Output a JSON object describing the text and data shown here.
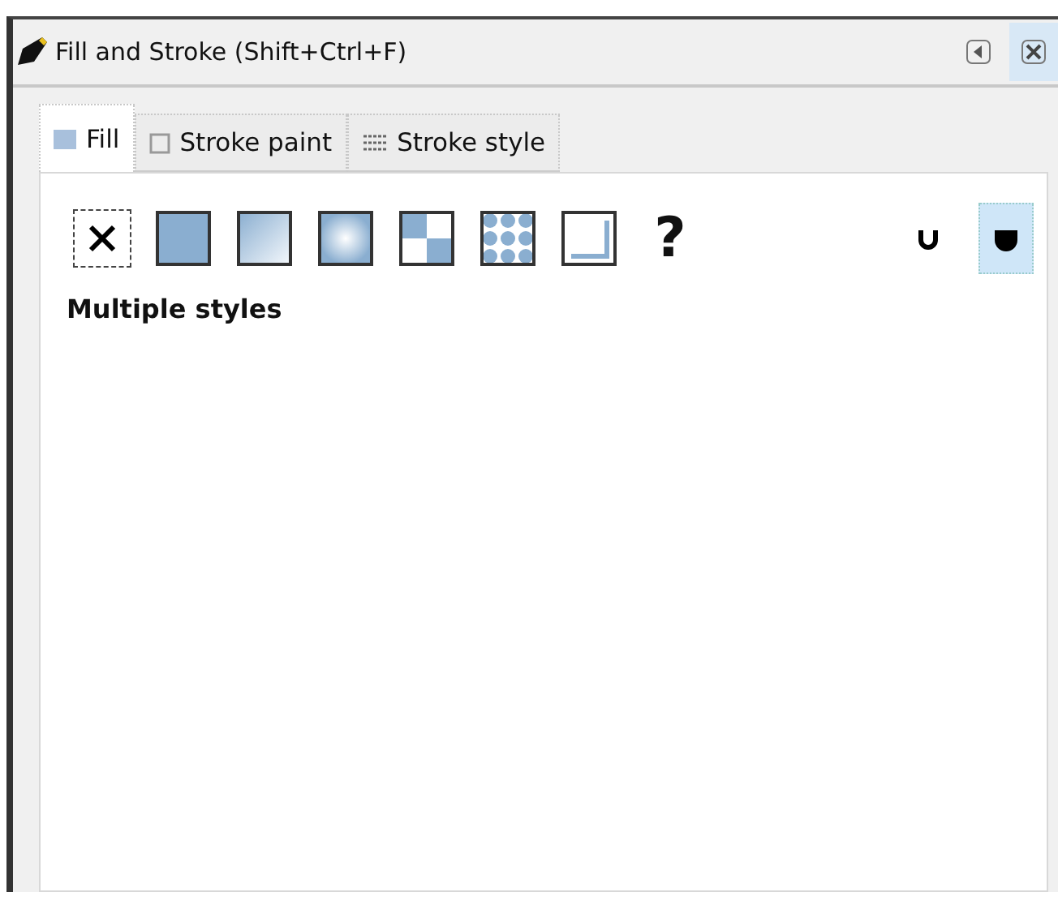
{
  "window": {
    "title": "Fill and Stroke (Shift+Ctrl+F)"
  },
  "tabs": [
    {
      "label": "Fill",
      "kind": "fill",
      "selected": true
    },
    {
      "label": "Stroke paint",
      "kind": "stroke",
      "selected": false
    },
    {
      "label": "Stroke style",
      "kind": "style",
      "selected": false
    }
  ],
  "paint_buttons": [
    {
      "kind": "none"
    },
    {
      "kind": "flat"
    },
    {
      "kind": "linear"
    },
    {
      "kind": "radial"
    },
    {
      "kind": "pattern"
    },
    {
      "kind": "swatch"
    },
    {
      "kind": "framed"
    },
    {
      "kind": "unset",
      "label": "?"
    }
  ],
  "fill_rules": [
    {
      "kind": "evenodd",
      "selected": false
    },
    {
      "kind": "nonzero",
      "selected": true
    }
  ],
  "status": "Multiple styles"
}
